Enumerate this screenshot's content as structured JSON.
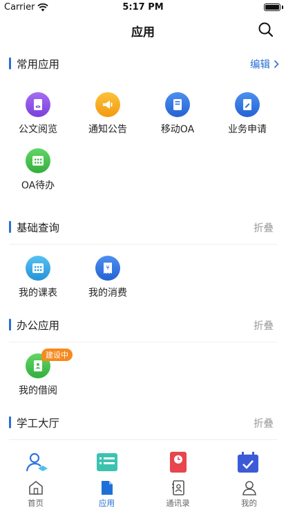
{
  "status_bar": {
    "carrier": "Carrier",
    "time": "5:17 PM"
  },
  "nav": {
    "title": "应用",
    "search_icon": "search-icon"
  },
  "sections": {
    "common": {
      "title": "常用应用",
      "action": "编辑"
    },
    "basic": {
      "title": "基础查询",
      "action": "折叠"
    },
    "office": {
      "title": "办公应用",
      "action": "折叠"
    },
    "student": {
      "title": "学工大厅",
      "action": "折叠"
    }
  },
  "apps": {
    "doc_reading": {
      "label": "公文阅览",
      "icon": "document-eye-icon",
      "color": "#8a4fe0"
    },
    "notice": {
      "label": "通知公告",
      "icon": "megaphone-icon",
      "color": "#f5a623"
    },
    "mobile_oa": {
      "label": "移动OA",
      "icon": "book-icon",
      "color": "#2f74e0"
    },
    "business_apply": {
      "label": "业务申请",
      "icon": "form-edit-icon",
      "color": "#2f74e0"
    },
    "oa_todo": {
      "label": "OA待办",
      "icon": "calendar-grid-icon",
      "color": "#43c04a"
    },
    "my_schedule": {
      "label": "我的课表",
      "icon": "calendar-grid-icon",
      "color": "#2fa8e8"
    },
    "my_consumption": {
      "label": "我的消费",
      "icon": "receipt-icon",
      "color": "#2f74e0"
    },
    "my_borrow": {
      "label": "我的借阅",
      "icon": "person-card-icon",
      "color": "#43c04a",
      "badge": "建设中"
    }
  },
  "tabs": [
    {
      "label": "首页",
      "icon": "home-icon",
      "active": false
    },
    {
      "label": "应用",
      "icon": "document-icon",
      "active": true
    },
    {
      "label": "通讯录",
      "icon": "contacts-icon",
      "active": false
    },
    {
      "label": "我的",
      "icon": "person-icon",
      "active": false
    }
  ],
  "colors": {
    "accent": "#2a6fd6",
    "badge": "#f68a1e",
    "muted": "#999999"
  }
}
